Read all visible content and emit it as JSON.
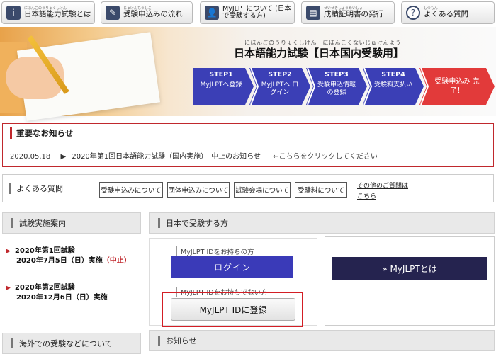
{
  "nav": [
    {
      "ruby": "にほんごのうりょくしけん",
      "label": "日本語能力試験とは",
      "icon": "info-icon",
      "glyph": "i"
    },
    {
      "ruby": "じゅけんもうしこ",
      "label": "受験申込みの流れ",
      "icon": "pencil-icon",
      "glyph": "✎"
    },
    {
      "ruby": "",
      "label": "MyJLPTについて (日本で受験する方)",
      "icon": "user-icon",
      "glyph": "👤"
    },
    {
      "ruby": "せいせきしょうめいしょ",
      "label": "成績証明書の発行",
      "icon": "certificate-icon",
      "glyph": "▤"
    },
    {
      "ruby": "しつもん",
      "label": "よくある質問",
      "icon": "question-icon",
      "glyph": "?"
    }
  ],
  "hero": {
    "ruby": "にほんごのうりょくしけん　にほんこくないじゅけんよう",
    "title": "日本語能力試験【日本国内受験用】",
    "steps": [
      {
        "step": "STEP1",
        "text": "MyJLPTへ登録",
        "color": "#3b3fb6"
      },
      {
        "step": "STEP2",
        "text": "MyJLPTへ ログイン",
        "color": "#3b3fb6"
      },
      {
        "step": "STEP3",
        "text": "受験申込情報 の登録",
        "color": "#3b3fb6"
      },
      {
        "step": "STEP4",
        "text": "受験料支払い",
        "color": "#3b3fb6"
      },
      {
        "step": "",
        "text": "受験申込み 完了！",
        "color": "#e23a3a"
      }
    ]
  },
  "notice": {
    "title": "重要なお知らせ",
    "date": "2020.05.18",
    "arrow": "▶",
    "body": "2020年第1回日本語能力試験（国内実施）　中止のお知らせ",
    "hint": "←こちらをクリックしてください"
  },
  "faq": {
    "title": "よくある質問",
    "chips": [
      "受験申込みについて",
      "団体申込みについて",
      "試験会場について",
      "受験料について"
    ],
    "other1": "その他のご質問は",
    "other2": "こちら"
  },
  "sections": {
    "exam_info": "試験実施案内",
    "japan": "日本で受験する方",
    "overseas": "海外での受験などについて",
    "news": "お知らせ"
  },
  "exams": [
    {
      "line1": "2020年第1回試験",
      "line2": "2020年7月5日（日）実施",
      "status": "（中止）"
    },
    {
      "line1": "2020年第2回試験",
      "line2": "2020年12月6日（日）実施",
      "status": ""
    }
  ],
  "japan_panel": {
    "has_id_label": "MyJLPT IDをお持ちの方",
    "login": "ログイン",
    "no_id_label": "MyJLPT IDをお持ちでない方",
    "register": "MyJLPT IDに登録"
  },
  "right_panel": {
    "button": "» MyJLPTとは"
  }
}
